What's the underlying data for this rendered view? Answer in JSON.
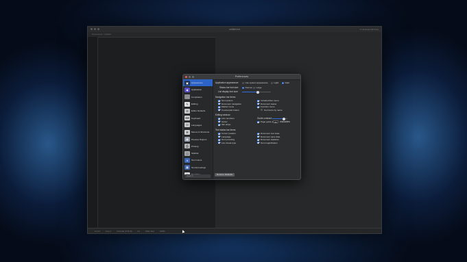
{
  "editor": {
    "title": "untitled.txt",
    "title_right": "1 Unsaved 100 lines",
    "path": "Documents / Untitled",
    "status": [
      "L1  C1",
      "Line 1",
      "Unicode (UTF-8)",
      "LF",
      "Plain Text",
      "100%"
    ]
  },
  "prefs": {
    "title": "Preferences",
    "sidebar": [
      {
        "label": "Appearance",
        "icon": "appearance-icon",
        "active": true
      },
      {
        "label": "Application",
        "icon": "application-icon"
      },
      {
        "label": "Completion",
        "icon": "completion-icon"
      },
      {
        "label": "Editing",
        "icon": "editing-icon"
      },
      {
        "label": "Editor Defaults",
        "icon": "editor-defaults-icon"
      },
      {
        "label": "Keyboard",
        "icon": "keyboard-icon"
      },
      {
        "label": "Languages",
        "icon": "languages-icon"
      },
      {
        "label": "Menus & Shortcuts",
        "icon": "menus-icon"
      },
      {
        "label": "Preview Helpers",
        "icon": "preview-icon"
      },
      {
        "label": "Printing",
        "icon": "printing-icon"
      },
      {
        "label": "Sidebar",
        "icon": "sidebar-icon"
      },
      {
        "label": "Text Colors",
        "icon": "text-colors-icon"
      },
      {
        "label": "Text Encodings",
        "icon": "text-encodings-icon"
      },
      {
        "label": "Text Files",
        "icon": "text-files-icon"
      }
    ],
    "search_placeholder": "Search",
    "appearance_label": "Application appearance:",
    "appearance_options": [
      "Use system appearance",
      "Light",
      "Dark"
    ],
    "status_bar_size_label": "Status bar font size:",
    "status_bar_size_options": [
      "Normal",
      "Large"
    ],
    "list_font_size_label": "List display font size:",
    "list_font_size_value": 0.55,
    "nav_section": "Navigation bar items:",
    "nav_left": [
      "Text options",
      "Document navigation",
      "Marker menu",
      "Counterpart button"
    ],
    "nav_right": [
      "Included files menu",
      "Document status",
      "Function menu"
    ],
    "nav_sort": "Sort items by name",
    "editing_section": "Editing window:",
    "editing_items": [
      "Line numbers",
      "Gutter",
      "Tab strips"
    ],
    "guide_contrast_label": "Guide contrast:",
    "guide_contrast_value": 0.75,
    "page_guide_label": "Page guide at",
    "page_guide_value": "80",
    "page_guide_unit": "characters",
    "status_section": "Text status bar items:",
    "status_left": [
      "Cursor position",
      "Language",
      "Text encoding",
      "Line break type"
    ],
    "status_right": [
      "Document text state",
      "Document save date",
      "Document statistics",
      "Text magnification"
    ],
    "restore_label": "Restore Defaults"
  },
  "colors": {
    "accent": "#2f6fe0",
    "selection": "#2d62c7",
    "close": "#ec5f57",
    "minimize": "#f4bd4f",
    "zoom": "#5fc653"
  }
}
